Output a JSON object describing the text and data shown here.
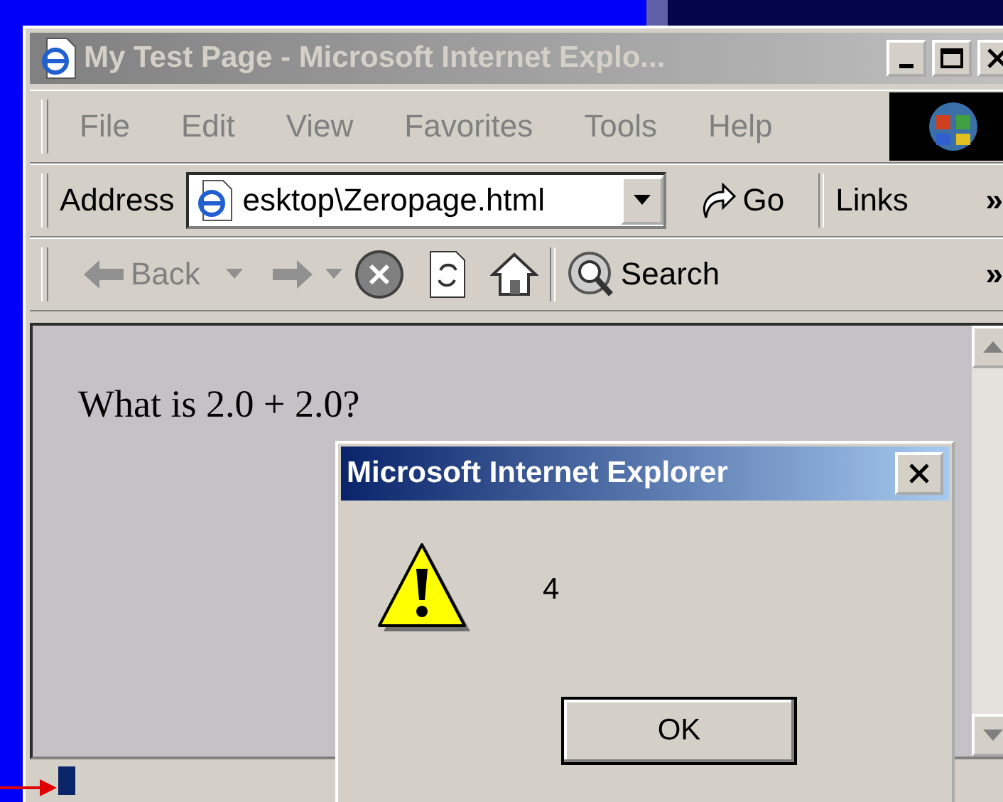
{
  "window": {
    "title": "My Test Page - Microsoft Internet Explo..."
  },
  "menu": [
    "File",
    "Edit",
    "View",
    "Favorites",
    "Tools",
    "Help"
  ],
  "address_bar": {
    "label": "Address",
    "value": "esktop\\Zeropage.html",
    "go": "Go",
    "links": "Links",
    "more": "»"
  },
  "toolbar": {
    "back": "Back",
    "search": "Search",
    "more": "»"
  },
  "page": {
    "question": "What is 2.0 + 2.0?"
  },
  "dialog": {
    "title": "Microsoft Internet Explorer",
    "message": "4",
    "button": "OK"
  }
}
